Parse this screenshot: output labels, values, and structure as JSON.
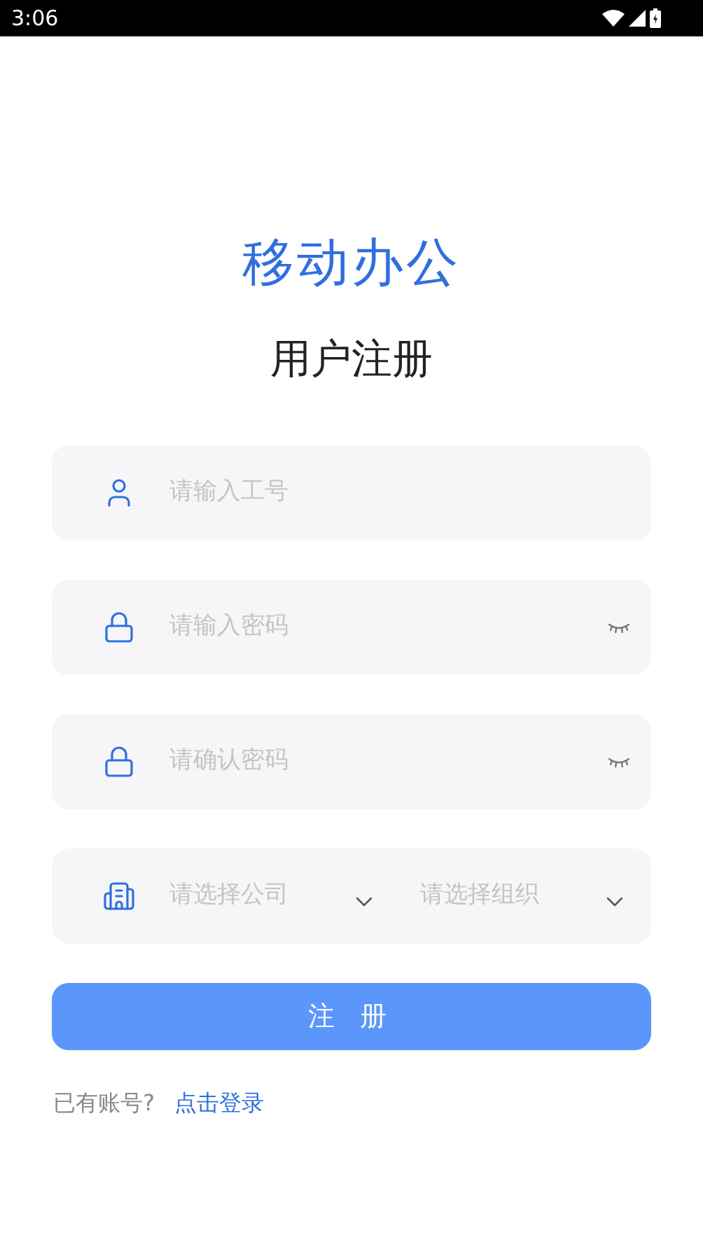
{
  "status_bar": {
    "time": "3:06"
  },
  "app_title": "移动办公",
  "page_title": "用户注册",
  "fields": [
    {
      "kind": "text",
      "placeholder": "请输入工号"
    },
    {
      "kind": "password",
      "placeholder": "请输入密码"
    },
    {
      "kind": "password",
      "placeholder": "请确认密码"
    },
    {
      "kind": "select",
      "selects": [
        {
          "placeholder": "请选择公司"
        },
        {
          "placeholder": "请选择组织"
        }
      ]
    }
  ],
  "submit_button": "注 册",
  "login_prompt": {
    "text": "已有账号?",
    "link": "点击登录"
  }
}
